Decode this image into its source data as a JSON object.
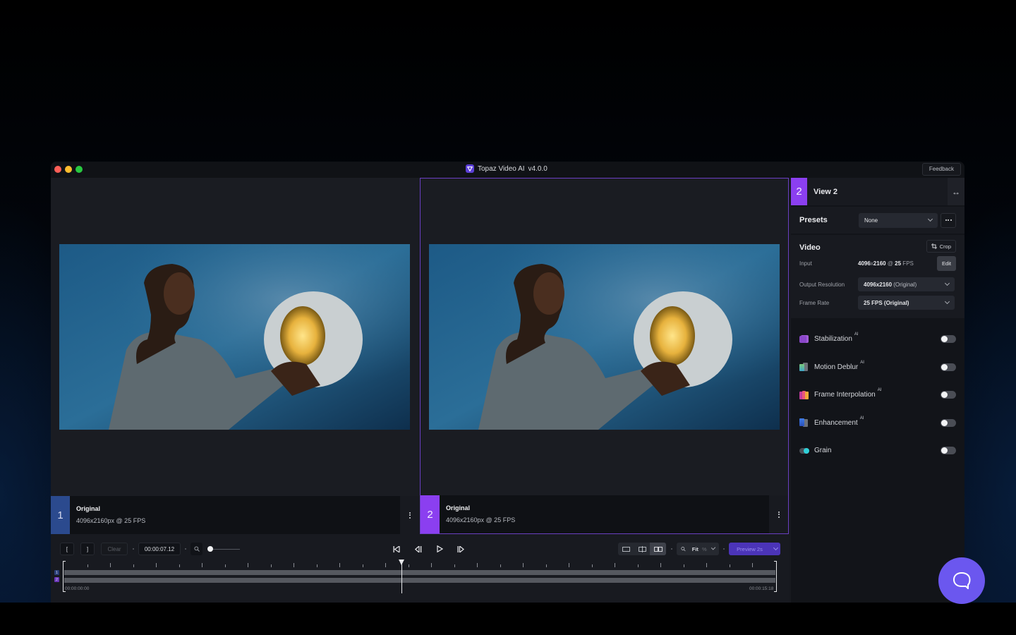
{
  "window": {
    "app_title": "Topaz Video AI",
    "version": "v4.0.0",
    "feedback_label": "Feedback"
  },
  "viewers": [
    {
      "number": "1",
      "name": "Original",
      "resolution": "4096x2160px @ 25 FPS",
      "accent": "#2b4a8e"
    },
    {
      "number": "2",
      "name": "Original",
      "resolution": "4096x2160px @ 25 FPS",
      "accent": "#8b3ff0"
    }
  ],
  "sidebar": {
    "view_number": "2",
    "view_title": "View 2",
    "expand_icon": "↔",
    "presets": {
      "title": "Presets",
      "selected": "None"
    },
    "video": {
      "title": "Video",
      "crop_label": "Crop",
      "input_label": "Input",
      "input_res": "4096",
      "input_x": "x",
      "input_res2": "2160",
      "input_at": " @ ",
      "input_fps": "25",
      "input_fps_unit": " FPS",
      "edit_label": "Edit",
      "output_label": "Output Resolution",
      "output_value": "4096x2160",
      "output_suffix": " (Original)",
      "framerate_label": "Frame Rate",
      "framerate_value": "25 FPS (Original)"
    },
    "features": [
      {
        "name": "Stabilization",
        "ai": "AI",
        "enabled": false
      },
      {
        "name": "Motion Deblur",
        "ai": "AI",
        "enabled": false
      },
      {
        "name": "Frame Interpolation",
        "ai": "AI",
        "enabled": false
      },
      {
        "name": "Enhancement",
        "ai": "AI",
        "enabled": false
      },
      {
        "name": "Grain",
        "ai": "",
        "enabled": false
      }
    ]
  },
  "controls": {
    "mark_in": "[",
    "mark_out": "]",
    "clear_label": "Clear",
    "current_time": "00:00:07.12",
    "zoom_label": "Fit",
    "zoom_unit": "%",
    "preview_label": "Preview 2s"
  },
  "timeline": {
    "start_time": "00:00:00:00",
    "end_time": "00:00:15:18",
    "playhead_fraction": 0.474,
    "tracks": [
      "1",
      "2"
    ]
  }
}
